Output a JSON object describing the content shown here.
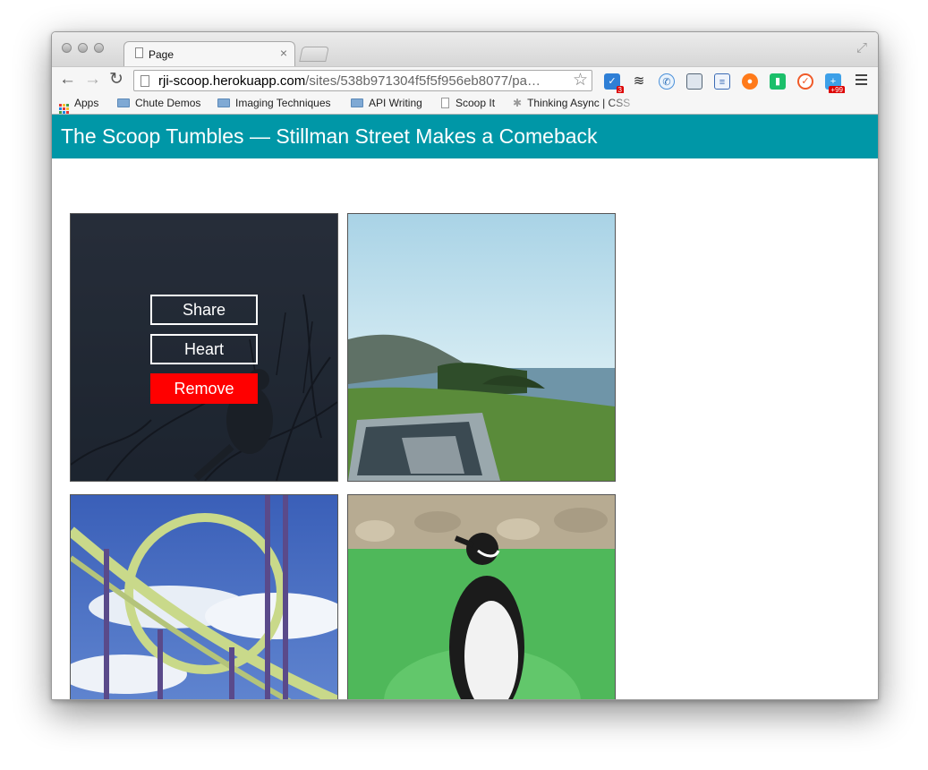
{
  "browser": {
    "tab_title": "Page",
    "tab_close": "×",
    "url_host": "rji-scoop.herokuapp.com",
    "url_path": "/sites/538b971304f5f5f956eb8077/pa…",
    "ext_badge_1": "3",
    "ext_badge_2": "+99"
  },
  "bookmarks": [
    {
      "label": "Apps"
    },
    {
      "label": "Chute Demos"
    },
    {
      "label": "Imaging Techniques"
    },
    {
      "label": "API Writing"
    },
    {
      "label": "Scoop It"
    },
    {
      "label": "Thinking Async | CSS"
    }
  ],
  "page": {
    "title": "The Scoop Tumbles — Stillman Street Makes a Comeback"
  },
  "overlay": {
    "share": "Share",
    "heart": "Heart",
    "remove": "Remove"
  },
  "colors": {
    "header": "#0097a7",
    "remove": "#ff0000"
  }
}
